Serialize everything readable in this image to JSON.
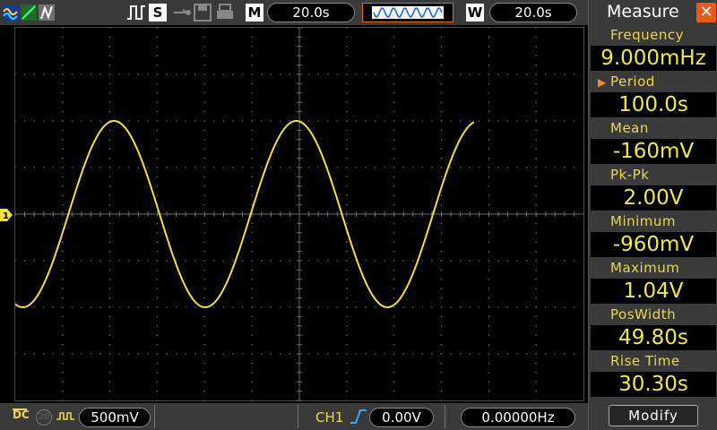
{
  "colors": {
    "trace": "#f0e040",
    "grid": "#6a6a6a",
    "bar": "#3a3a3a",
    "label": "#e8d84a",
    "close": "#e85a1c",
    "selection": "#ff8a1c"
  },
  "toolbar": {
    "icons": [
      "waveform-icon",
      "line-icon",
      "snapshot-icon",
      "pulse-icon",
      "usb-icon",
      "disk-icon",
      "print-icon"
    ],
    "s_label": "S",
    "m_label": "M",
    "m_timebase": "20.0s",
    "w_label": "W",
    "w_timebase": "20.0s"
  },
  "screen": {
    "channel_marker": "1",
    "grid": true,
    "waveform": {
      "type": "sine",
      "amplitude_div": 2,
      "offset_div": 0,
      "period_div": 3.85,
      "phase_start_deg": 255,
      "start_div": 0,
      "end_div": 9.7
    }
  },
  "bottombar": {
    "coupling": "DC",
    "bw_limit": "20",
    "volts_div": "500mV",
    "trigger_source": "CH1",
    "trigger_level": "0.00V",
    "trigger_freq": "0.00000Hz"
  },
  "measure_panel": {
    "title": "Measure",
    "close_symbol": "✕",
    "selected_index": 1,
    "selector_symbol": "▶",
    "items": [
      {
        "label": "Frequency",
        "value": "9.000mHz"
      },
      {
        "label": "Period",
        "value": "100.0s"
      },
      {
        "label": "Mean",
        "value": "-160mV"
      },
      {
        "label": "Pk-Pk",
        "value": "2.00V"
      },
      {
        "label": "Minimum",
        "value": "-960mV"
      },
      {
        "label": "Maximum",
        "value": "1.04V"
      },
      {
        "label": "PosWidth",
        "value": "49.80s"
      },
      {
        "label": "Rise Time",
        "value": "30.30s"
      }
    ],
    "modify_label": "Modify"
  }
}
